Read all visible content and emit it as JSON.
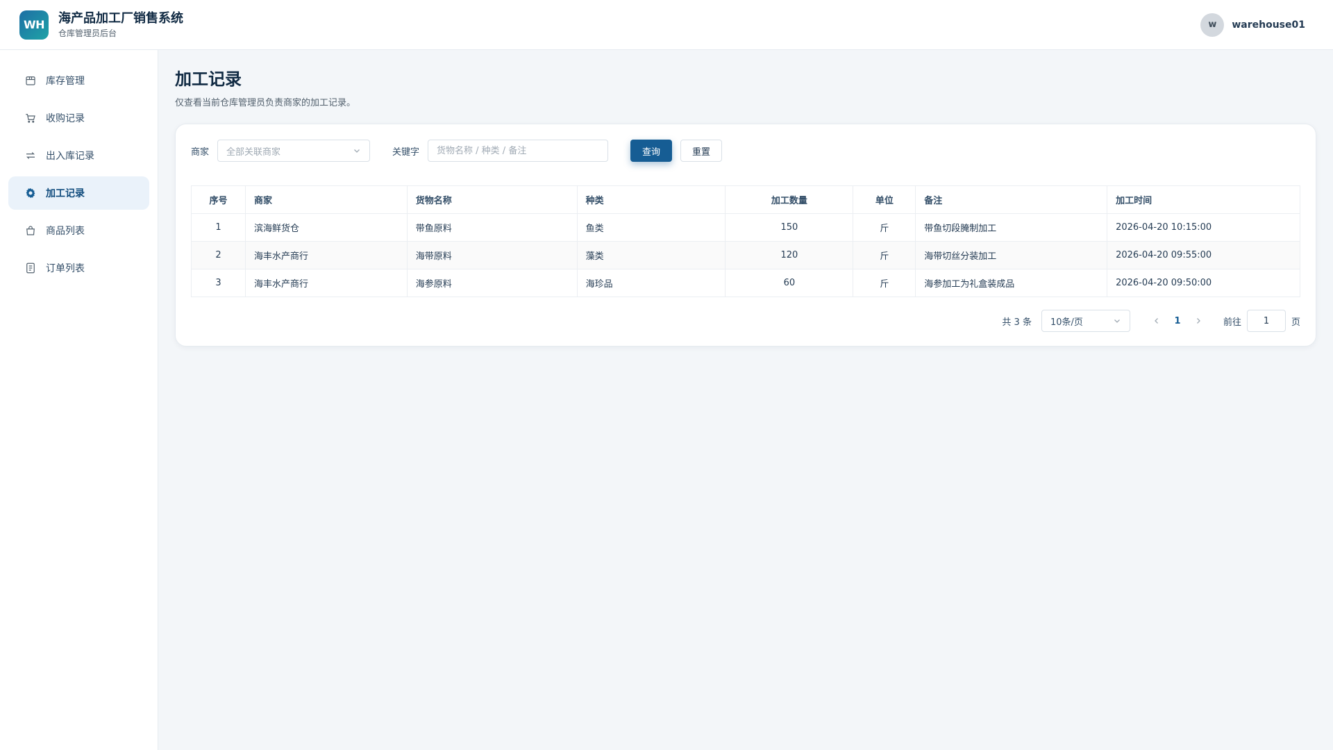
{
  "header": {
    "logo_text": "WH",
    "title": "海产品加工厂销售系统",
    "subtitle": "仓库管理员后台",
    "avatar_letter": "w",
    "username": "warehouse01"
  },
  "sidebar": {
    "items": [
      {
        "label": "库存管理",
        "icon": "box-icon",
        "active": false
      },
      {
        "label": "收购记录",
        "icon": "cart-icon",
        "active": false
      },
      {
        "label": "出入库记录",
        "icon": "transfer-icon",
        "active": false
      },
      {
        "label": "加工记录",
        "icon": "gear-icon",
        "active": true
      },
      {
        "label": "商品列表",
        "icon": "bag-icon",
        "active": false
      },
      {
        "label": "订单列表",
        "icon": "document-icon",
        "active": false
      }
    ]
  },
  "main": {
    "title": "加工记录",
    "description": "仅查看当前仓库管理员负责商家的加工记录。"
  },
  "filters": {
    "merchant_label": "商家",
    "merchant_placeholder": "全部关联商家",
    "keyword_label": "关键字",
    "keyword_placeholder": "货物名称 / 种类 / 备注",
    "query_button": "查询",
    "reset_button": "重置"
  },
  "table": {
    "columns": [
      "序号",
      "商家",
      "货物名称",
      "种类",
      "加工数量",
      "单位",
      "备注",
      "加工时间"
    ],
    "rows": [
      [
        "1",
        "滨海鲜货仓",
        "带鱼原料",
        "鱼类",
        "150",
        "斤",
        "带鱼切段腌制加工",
        "2026-04-20 10:15:00"
      ],
      [
        "2",
        "海丰水产商行",
        "海带原料",
        "藻类",
        "120",
        "斤",
        "海带切丝分装加工",
        "2026-04-20 09:55:00"
      ],
      [
        "3",
        "海丰水产商行",
        "海参原料",
        "海珍品",
        "60",
        "斤",
        "海参加工为礼盒装成品",
        "2026-04-20 09:50:00"
      ]
    ]
  },
  "pagination": {
    "total": "共 3 条",
    "page_size": "10条/页",
    "current_page": "1",
    "goto_label": "前往",
    "goto_value": "1",
    "goto_suffix": "页"
  },
  "colors": {
    "primary": "#165d94",
    "active_bg": "#eaf2fa",
    "page_bg": "#f3f6f9"
  }
}
